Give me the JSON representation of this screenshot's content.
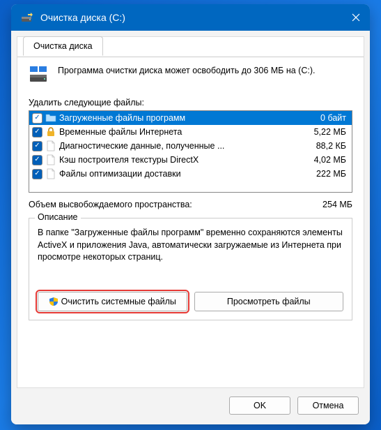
{
  "window": {
    "title": "Очистка диска  (C:)"
  },
  "tab": {
    "label": "Очистка диска"
  },
  "info": {
    "text": "Программа очистки диска может освободить до 306 МБ на (C:)."
  },
  "list": {
    "label": "Удалить следующие файлы:",
    "items": [
      {
        "name": "Загруженные файлы программ",
        "size": "0 байт",
        "checked": true,
        "selected": true,
        "icon": "folder"
      },
      {
        "name": "Временные файлы Интернета",
        "size": "5,22 МБ",
        "checked": true,
        "selected": false,
        "icon": "lock"
      },
      {
        "name": "Диагностические данные, полученные ...",
        "size": "88,2 КБ",
        "checked": true,
        "selected": false,
        "icon": "file"
      },
      {
        "name": "Кэш построителя текстуры DirectX",
        "size": "4,02 МБ",
        "checked": true,
        "selected": false,
        "icon": "file"
      },
      {
        "name": "Файлы оптимизации доставки",
        "size": "222 МБ",
        "checked": true,
        "selected": false,
        "icon": "file"
      }
    ]
  },
  "total": {
    "label": "Объем высвобождаемого пространства:",
    "value": "254 МБ"
  },
  "description": {
    "legend": "Описание",
    "text": "В папке \"Загруженные файлы программ\" временно сохраняются элементы ActiveX и приложения Java, автоматически загружаемые из Интернета при просмотре некоторых страниц."
  },
  "buttons": {
    "clean_system": "Очистить системные файлы",
    "view_files": "Просмотреть файлы",
    "ok": "OK",
    "cancel": "Отмена"
  }
}
